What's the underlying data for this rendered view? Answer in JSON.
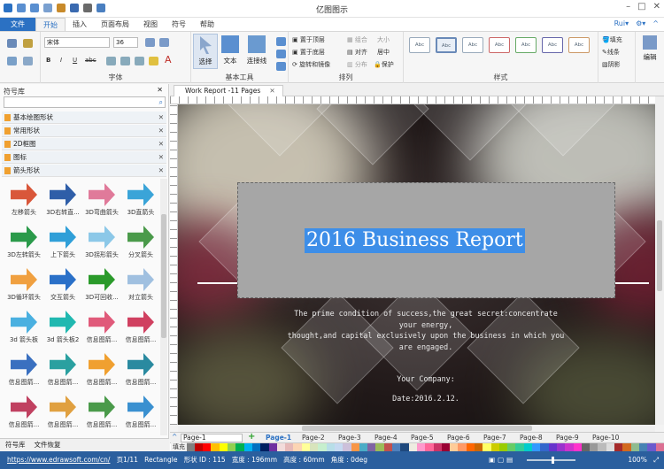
{
  "app": {
    "title": "亿图图示"
  },
  "menu": {
    "file": "文件",
    "items": [
      "开始",
      "插入",
      "页面布局",
      "视图",
      "符号",
      "帮助"
    ],
    "active": "开始",
    "user": "Rui",
    "user_arrow": "▾",
    "settings_arrow": "▾",
    "collapse": "^"
  },
  "ribbon": {
    "font_name": "宋体",
    "font_size": "36",
    "font_group": "字体",
    "bold": "B",
    "italic": "I",
    "underline": "U",
    "strike": "abc",
    "font_color": "A",
    "tools_group": "基本工具",
    "select": "选择",
    "text": "文本",
    "connector": "连接线",
    "arrange_group": "排列",
    "arrange": {
      "bring_front": "置于顶层",
      "group": "组合",
      "size": "大小",
      "send_back": "置于底层",
      "align": "对齐",
      "center": "居中",
      "rotate": "旋转和镜像",
      "distribute": "分布",
      "protect": "保护"
    },
    "style_group": "样式",
    "style_boxes": [
      "Abc",
      "Abc",
      "Abc",
      "Abc",
      "Abc",
      "Abc",
      "Abc"
    ],
    "fill": "填充",
    "line": "线条",
    "shadow": "阴影",
    "edit": "编辑"
  },
  "library": {
    "title": "符号库",
    "categories": [
      "基本绘图形状",
      "常用形状",
      "2D框图",
      "图标",
      "箭头形状"
    ],
    "shapes": [
      {
        "label": "左移箭头",
        "color": "#d9573a"
      },
      {
        "label": "3D右转直...",
        "color": "#2f5ea8"
      },
      {
        "label": "3D弯曲箭头",
        "color": "#e07a9a"
      },
      {
        "label": "3D直箭头",
        "color": "#3aa4d8"
      },
      {
        "label": "3D左转箭头",
        "color": "#2a9a4a"
      },
      {
        "label": "上下箭头",
        "color": "#2f9fd8"
      },
      {
        "label": "3D拐形箭头",
        "color": "#8cc8e8"
      },
      {
        "label": "分叉箭头",
        "color": "#4a9a4a"
      },
      {
        "label": "3D循环箭头",
        "color": "#f0a040"
      },
      {
        "label": "交互箭头",
        "color": "#2a70c8"
      },
      {
        "label": "3D可回收...",
        "color": "#2a9a2a"
      },
      {
        "label": "对立箭头",
        "color": "#a0c0e0"
      },
      {
        "label": "3d 箭头板",
        "color": "#4ab0e0"
      },
      {
        "label": "3d 箭头板2",
        "color": "#20b8b0"
      },
      {
        "label": "信息图箭...",
        "color": "#e05a7a"
      },
      {
        "label": "信息图箭...",
        "color": "#d04060"
      },
      {
        "label": "信息图箭...",
        "color": "#3a70c0"
      },
      {
        "label": "信息图箭...",
        "color": "#2aa0a0"
      },
      {
        "label": "信息图箭...",
        "color": "#f0a030"
      },
      {
        "label": "信息图箭...",
        "color": "#2a8aa0"
      },
      {
        "label": "信息图箭...",
        "color": "#c04060"
      },
      {
        "label": "信息图箭...",
        "color": "#e0a040"
      },
      {
        "label": "信息图箭...",
        "color": "#4a9a4a"
      },
      {
        "label": "信息图箭...",
        "color": "#3a90d0"
      }
    ],
    "bottom_tabs": [
      "符号库",
      "文件恢复"
    ]
  },
  "document": {
    "tab_label": "Work Report -11 Pages",
    "title": "2016 Business Report",
    "caption_lines": [
      "The prime condition of success,the great secret:concentrate",
      "your energy,",
      "thought,and capital exclusively upon the business in which you",
      "are engaged."
    ],
    "company": "Your Company:",
    "date": "Date:2016.2.12."
  },
  "pages": {
    "selector": "Page-1",
    "tabs": [
      "Page-1",
      "Page-2",
      "Page-3",
      "Page-4",
      "Page-5",
      "Page-6",
      "Page-7",
      "Page-8",
      "Page-9",
      "Page-10"
    ],
    "active": "Page-1"
  },
  "palette_label": "填充",
  "palette": [
    "#ffffff",
    "#000000",
    "#7f7f7f",
    "#c00000",
    "#ff0000",
    "#ffc000",
    "#ffff00",
    "#92d050",
    "#00b050",
    "#00b0f0",
    "#0070c0",
    "#002060",
    "#7030a0",
    "#f2dcdb",
    "#e6b9b8",
    "#fcd5b4",
    "#ffff99",
    "#d8e4bc",
    "#c6efce",
    "#b7dee8",
    "#c5d9f1",
    "#ccc0da",
    "#f79646",
    "#4bacc6",
    "#8064a2",
    "#9bbb59",
    "#c0504d",
    "#4f81bd",
    "#1f497d",
    "#eeece1",
    "#ff99cc",
    "#ff6699",
    "#cc3366",
    "#990033",
    "#ffcc99",
    "#ff9966",
    "#ff6600",
    "#cc6600",
    "#ffff66",
    "#cccc00",
    "#99cc00",
    "#66cc66",
    "#33cc99",
    "#00cccc",
    "#3399ff",
    "#3366cc",
    "#6633cc",
    "#9933cc",
    "#cc33cc",
    "#ff33cc",
    "#666666",
    "#999999",
    "#bbbbbb",
    "#dddddd",
    "#a52a2a",
    "#d2691e",
    "#8fbc8f",
    "#4682b4",
    "#6a5acd",
    "#db7093"
  ],
  "status": {
    "link": "https://www.edrawsoft.com/cn/",
    "page": "页1/11",
    "shape": "Rectangle",
    "shape_id": "形状 ID : 115",
    "width": "宽度 : 196mm",
    "height": "高度 : 60mm",
    "angle": "角度 : 0deg",
    "zoom": "100%"
  }
}
